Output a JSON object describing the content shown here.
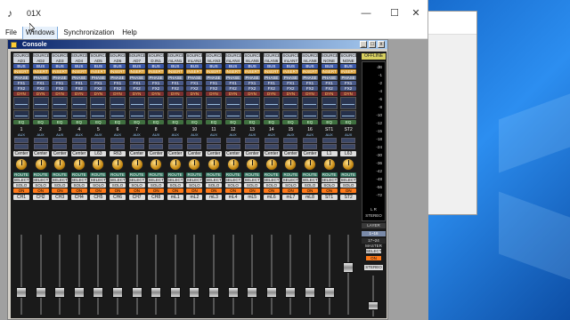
{
  "app": {
    "title": "01X",
    "icon": "app-logo-icon"
  },
  "window_controls": {
    "minimize": "—",
    "maximize": "☐",
    "close": "✕"
  },
  "menu": [
    "File",
    "Windows",
    "Synchronization",
    "Help"
  ],
  "console": {
    "title": "Console",
    "controls": {
      "minimize": "_",
      "maximize": "□",
      "close": "x"
    }
  },
  "strip_buttons": {
    "source_top": "SOURCE",
    "bus": "BUS",
    "insert": "INSERT",
    "phase": "PHASE",
    "fx1": "FX1",
    "fx2": "FX2",
    "dyn": "DYN",
    "eq": "EQ",
    "aux": "AUX",
    "route": "ROUTE",
    "select": "SELECT",
    "solo": "SOLO",
    "on": "ON"
  },
  "channels": [
    {
      "src": "AD1",
      "num": "1",
      "pan": "Center",
      "name": "CH1",
      "fader": 0.25
    },
    {
      "src": "AD2",
      "num": "2",
      "pan": "Center",
      "name": "CH2",
      "fader": 0.25
    },
    {
      "src": "AD3",
      "num": "3",
      "pan": "Center",
      "name": "CH3",
      "fader": 0.25
    },
    {
      "src": "AD4",
      "num": "4",
      "pan": "Center",
      "name": "CH4",
      "fader": 0.25
    },
    {
      "src": "AD5",
      "num": "5",
      "pan": "L63",
      "name": "CH5",
      "fader": 0.25
    },
    {
      "src": "AD6",
      "num": "6",
      "pan": "R63",
      "name": "CH6",
      "fader": 0.25
    },
    {
      "src": "AD7",
      "num": "7",
      "pan": "Center",
      "name": "CH7",
      "fader": 0.25
    },
    {
      "src": "D.IN1",
      "num": "8",
      "pan": "Center",
      "name": "CH8",
      "fader": 0.25
    },
    {
      "src": "mLAN1",
      "num": "9",
      "pan": "Center",
      "name": "mL1",
      "fader": 0.25
    },
    {
      "src": "mLAN2",
      "num": "10",
      "pan": "Center",
      "name": "mL2",
      "fader": 0.25
    },
    {
      "src": "mLAN3",
      "num": "11",
      "pan": "Center",
      "name": "mL3",
      "fader": 0.25
    },
    {
      "src": "mLAN4",
      "num": "12",
      "pan": "Center",
      "name": "mL4",
      "fader": 0.25
    },
    {
      "src": "mLAN5",
      "num": "13",
      "pan": "Center",
      "name": "mL5",
      "fader": 0.25
    },
    {
      "src": "mLAN6",
      "num": "14",
      "pan": "Center",
      "name": "mL6",
      "fader": 0.25
    },
    {
      "src": "mLAN7",
      "num": "15",
      "pan": "Center",
      "name": "mL7",
      "fader": 0.25
    },
    {
      "src": "mLAN8",
      "num": "16",
      "pan": "Center",
      "name": "mL8",
      "fader": 0.25
    },
    {
      "src": "NONE",
      "num": "ST1",
      "pan": "L1",
      "name": "ST1",
      "fader": 0.25
    },
    {
      "src": "NONE",
      "num": "ST2",
      "pan": "L63",
      "name": "ST2",
      "fader": 0.6
    }
  ],
  "master": {
    "status": "OFFLINE",
    "meter_labels": [
      "dB",
      "-1",
      "-2",
      "-4",
      "-6",
      "-8",
      "-10",
      "-12",
      "-15",
      "-18",
      "-24",
      "-30",
      "-36",
      "-42",
      "-48",
      "-56",
      "-72"
    ],
    "meter_lr": "L      R",
    "stereo": "STEREO",
    "layer": "LAYER",
    "layer_readout": "1~16",
    "master_label": "17~24 MASTER",
    "select": "SELECT",
    "on": "ON",
    "name": "STEREO",
    "fader": 0.2
  }
}
